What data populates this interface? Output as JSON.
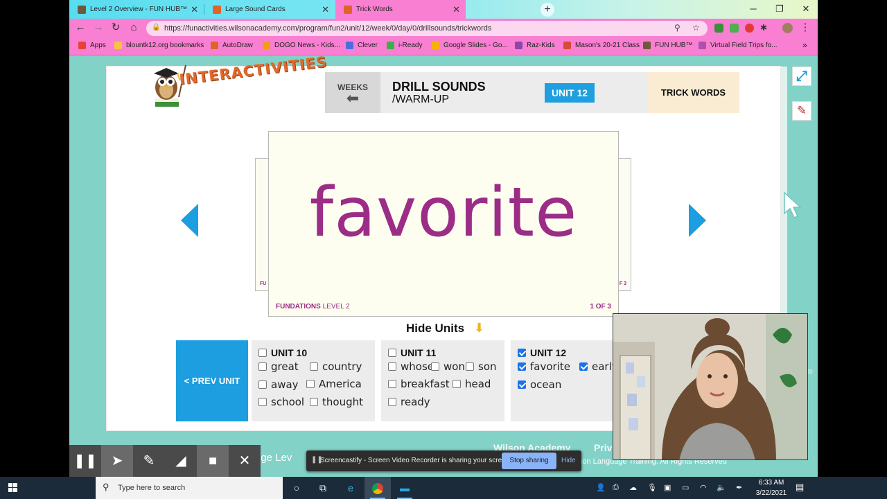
{
  "browser": {
    "tabs": [
      {
        "title": "Level 2 Overview - FUN HUB™",
        "favicon_color": "#6d5a3b"
      },
      {
        "title": "Large Sound Cards",
        "favicon_color": "#e0632a"
      },
      {
        "title": "Trick Words",
        "favicon_color": "#e0632a"
      }
    ],
    "url": "https://funactivities.wilsonacademy.com/program/fun2/unit/12/week/0/day/0/drillsounds/trickwords",
    "bookmarks": [
      {
        "label": "Apps",
        "color": "#e94235"
      },
      {
        "label": "blountk12.org bookmarks",
        "color": "#f4c542"
      },
      {
        "label": "AutoDraw",
        "color": "#e0632a"
      },
      {
        "label": "DOGO News - Kids...",
        "color": "#f59b1c"
      },
      {
        "label": "Clever",
        "color": "#4a6ee0"
      },
      {
        "label": "i-Ready",
        "color": "#3fae49"
      },
      {
        "label": "Google Slides - Go...",
        "color": "#f4b400"
      },
      {
        "label": "Raz-Kids",
        "color": "#8e44ad"
      },
      {
        "label": "Mason's 20-21 Class",
        "color": "#d44c3c"
      },
      {
        "label": "FUN HUB™",
        "color": "#6d5a3b"
      },
      {
        "label": "Virtual Field Trips fo...",
        "color": "#b04fae"
      }
    ],
    "bookmarks_overflow": "»"
  },
  "header": {
    "logo_text": "INTERACTIVITIES",
    "weeks_label": "WEEKS",
    "title": "DRILL SOUNDS",
    "subtitle": "/WARM-UP",
    "unit_badge": "UNIT 12",
    "section": "TRICK WORDS"
  },
  "card": {
    "word": "favorite",
    "brand": "FUNDATIONS",
    "level": "LEVEL 2",
    "count": "1 OF 3",
    "side_left": "FU",
    "side_right": "F 3"
  },
  "hide_units_label": "Hide Units",
  "prev_unit_label": "< PREV UNIT",
  "units": [
    {
      "title": "UNIT 10",
      "checked": false,
      "words": [
        {
          "text": "great",
          "checked": false
        },
        {
          "text": "country",
          "checked": false
        },
        {
          "text": "away",
          "checked": false
        },
        {
          "text": "America",
          "checked": false
        },
        {
          "text": "school",
          "checked": false
        },
        {
          "text": "thought",
          "checked": false
        }
      ]
    },
    {
      "title": "UNIT 11",
      "checked": false,
      "words": [
        {
          "text": "whose",
          "checked": false
        },
        {
          "text": "won",
          "checked": false
        },
        {
          "text": "son",
          "checked": false
        },
        {
          "text": "breakfast",
          "checked": false
        },
        {
          "text": "head",
          "checked": false
        },
        {
          "text": "ready",
          "checked": false
        }
      ]
    },
    {
      "title": "UNIT 12",
      "checked": true,
      "words": [
        {
          "text": "favorite",
          "checked": true
        },
        {
          "text": "early",
          "checked": true
        },
        {
          "text": "ocean",
          "checked": true
        }
      ]
    }
  ],
  "footer": {
    "left": "nge Lev",
    "brand": "Wilson Academy",
    "privacy": "Priv",
    "copyright": "ilson Language Training. All Rights Reserved"
  },
  "screencastify": {
    "message": "Screencastify - Screen Video Recorder is sharing your screen.",
    "stop": "Stop sharing",
    "hide": "Hide"
  },
  "taskbar": {
    "search_placeholder": "Type here to search",
    "time": "6:33 AM",
    "date": "3/22/2021"
  },
  "colors": {
    "accent_blue": "#1c9ee0",
    "card_word": "#9b2d87",
    "chrome_pink": "#f87fd1",
    "page_teal": "#82d2c8"
  }
}
